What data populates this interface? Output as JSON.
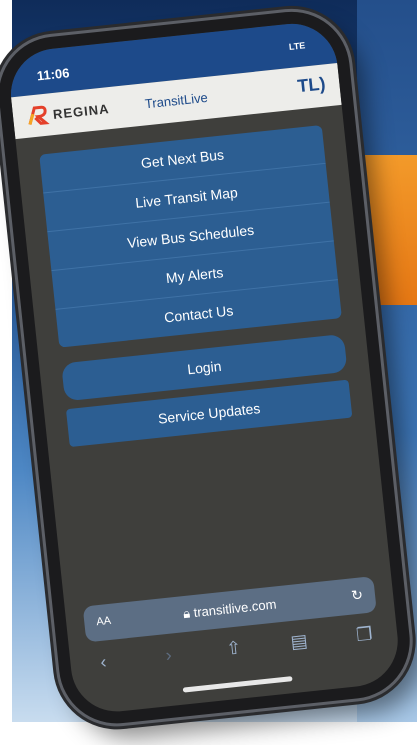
{
  "status": {
    "time": "11:06",
    "network": "LTE"
  },
  "header": {
    "brand": "REGINA",
    "title": "TransitLive",
    "logo_text": "TL"
  },
  "menu": [
    {
      "label": "Get Next Bus"
    },
    {
      "label": "Live Transit Map"
    },
    {
      "label": "View Bus Schedules"
    },
    {
      "label": "My Alerts"
    },
    {
      "label": "Contact Us"
    }
  ],
  "buttons": {
    "login": "Login",
    "service_updates": "Service Updates"
  },
  "browser": {
    "aa": "AA",
    "url": "transitlive.com"
  },
  "colors": {
    "nav_blue": "#1d4a8a",
    "menu_blue": "#2c5e92",
    "screen_bg": "#3f3f3c",
    "accent_orange": "#f39a2a"
  },
  "icons": [
    "lock-icon",
    "reload-icon",
    "back-icon",
    "forward-icon",
    "share-icon",
    "bookmarks-icon",
    "tabs-icon"
  ]
}
